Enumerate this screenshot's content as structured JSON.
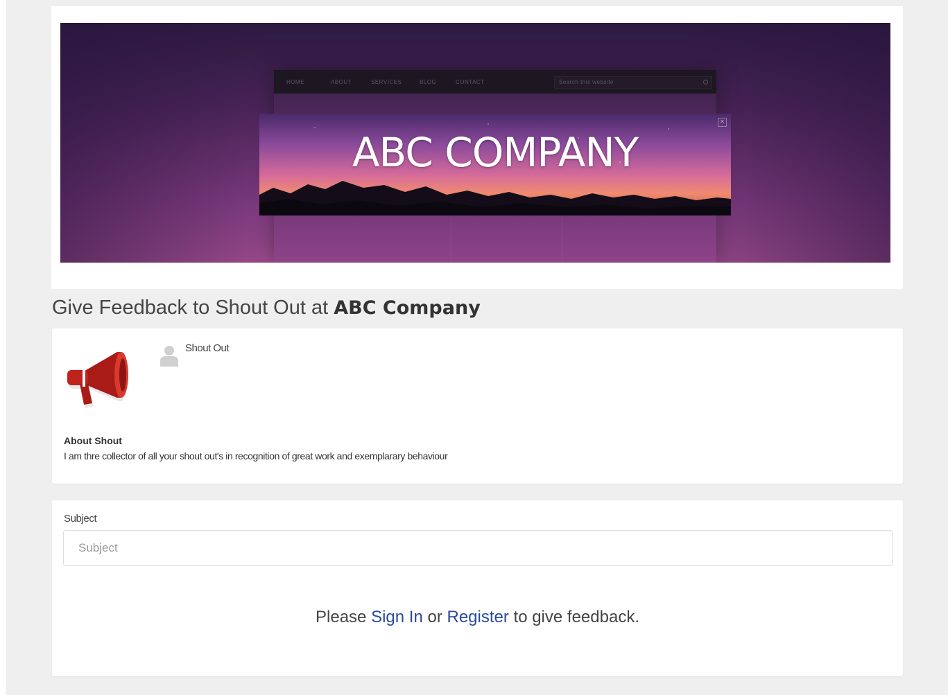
{
  "banner": {
    "hero_title": "ABC COMPANY",
    "nav_items": [
      "HOME",
      "ABOUT",
      "SERVICES",
      "BLOG",
      "CONTACT"
    ],
    "search_placeholder": "Search this website"
  },
  "heading": {
    "prefix": "Give Feedback to Shout Out at ",
    "company": "ABC Company"
  },
  "profile": {
    "name": "Shout Out",
    "about_label": "About Shout",
    "about_text": "I am thre collector of all your shout out's in recognition of great work and exemplarary behaviour"
  },
  "form": {
    "subject_label": "Subject",
    "subject_placeholder": "Subject",
    "subject_value": "",
    "prompt_before": "Please ",
    "sign_in_label": "Sign In",
    "prompt_middle": " or ",
    "register_label": "Register",
    "prompt_after": " to give feedback."
  },
  "colors": {
    "page_background": "#efefef",
    "card_background": "#ffffff",
    "link": "#2a4a9a",
    "megaphone_red": "#c0231c"
  },
  "icons": {
    "profile_image": "megaphone-icon",
    "user_avatar": "user-icon"
  }
}
